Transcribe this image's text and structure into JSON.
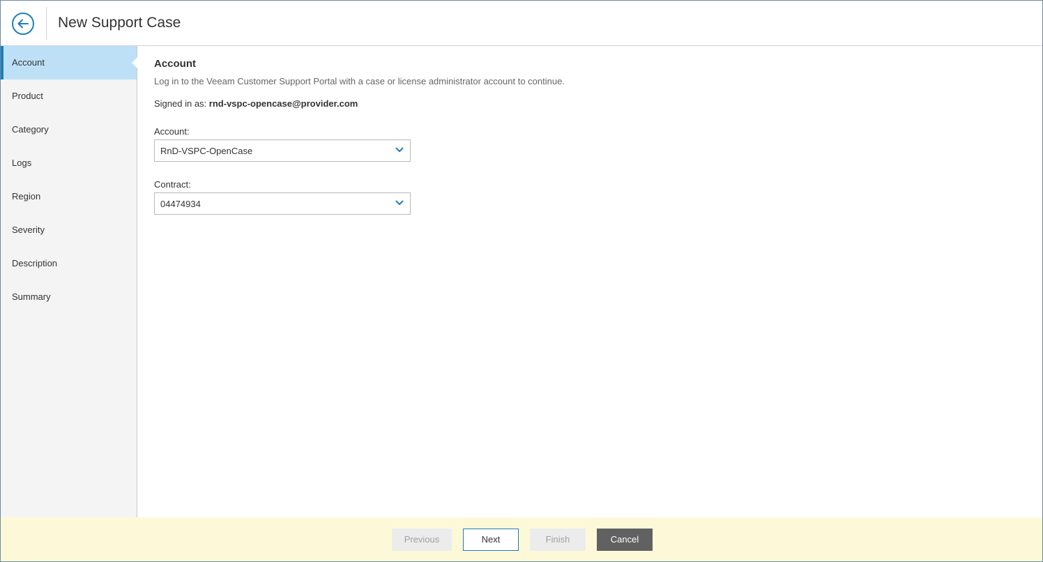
{
  "header": {
    "title": "New Support Case",
    "back_icon": "arrow-left-circle-icon"
  },
  "sidebar": {
    "items": [
      {
        "label": "Account",
        "active": true
      },
      {
        "label": "Product"
      },
      {
        "label": "Category"
      },
      {
        "label": "Logs"
      },
      {
        "label": "Region"
      },
      {
        "label": "Severity"
      },
      {
        "label": "Description"
      },
      {
        "label": "Summary"
      }
    ]
  },
  "main": {
    "title": "Account",
    "description": "Log in to the Veeam Customer Support Portal with a case or license administrator account to continue.",
    "signed_in_prefix": "Signed in as:",
    "signed_in_user": "rnd-vspc-opencase@provider.com",
    "account_label": "Account:",
    "account_value": "RnD-VSPC-OpenCase",
    "contract_label": "Contract:",
    "contract_value": "04474934"
  },
  "footer": {
    "previous_label": "Previous",
    "next_label": "Next",
    "finish_label": "Finish",
    "cancel_label": "Cancel"
  },
  "colors": {
    "accent": "#1d7fb8",
    "active_nav_bg": "#bde0f7",
    "footer_bg": "#fdf9d8",
    "cancel_bg": "#616161"
  }
}
